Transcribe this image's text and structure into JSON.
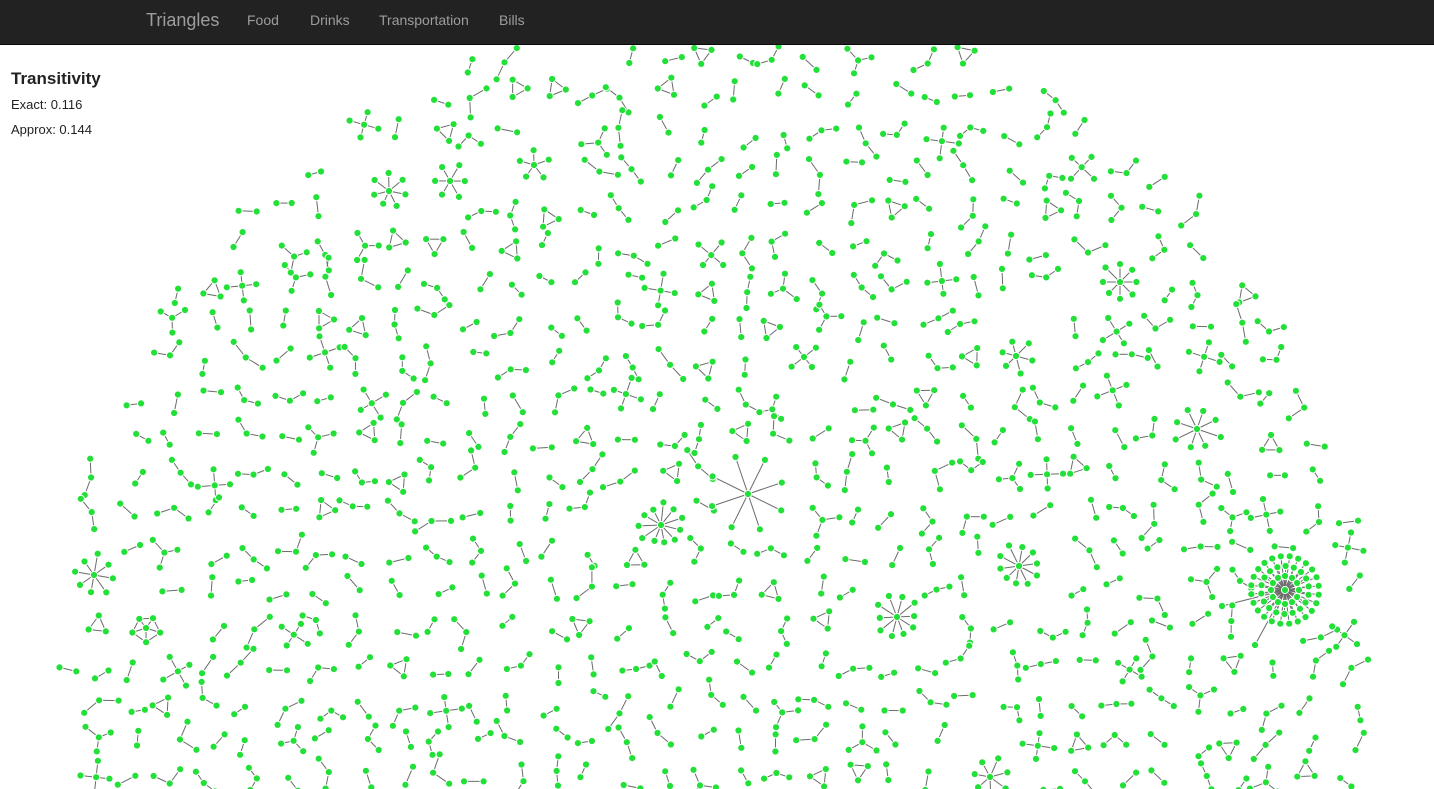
{
  "navbar": {
    "brand": "Triangles",
    "links": [
      "Food",
      "Drinks",
      "Transportation",
      "Bills"
    ]
  },
  "stats": {
    "heading": "Transitivity",
    "exact": "Exact: 0.116",
    "approx": "Approx: 0.144"
  },
  "graph": {
    "node_color": "#22e037",
    "edge_color": "#6b6b6b",
    "navbar_color": "#222222",
    "nav_text_color": "#9d9d9d"
  }
}
